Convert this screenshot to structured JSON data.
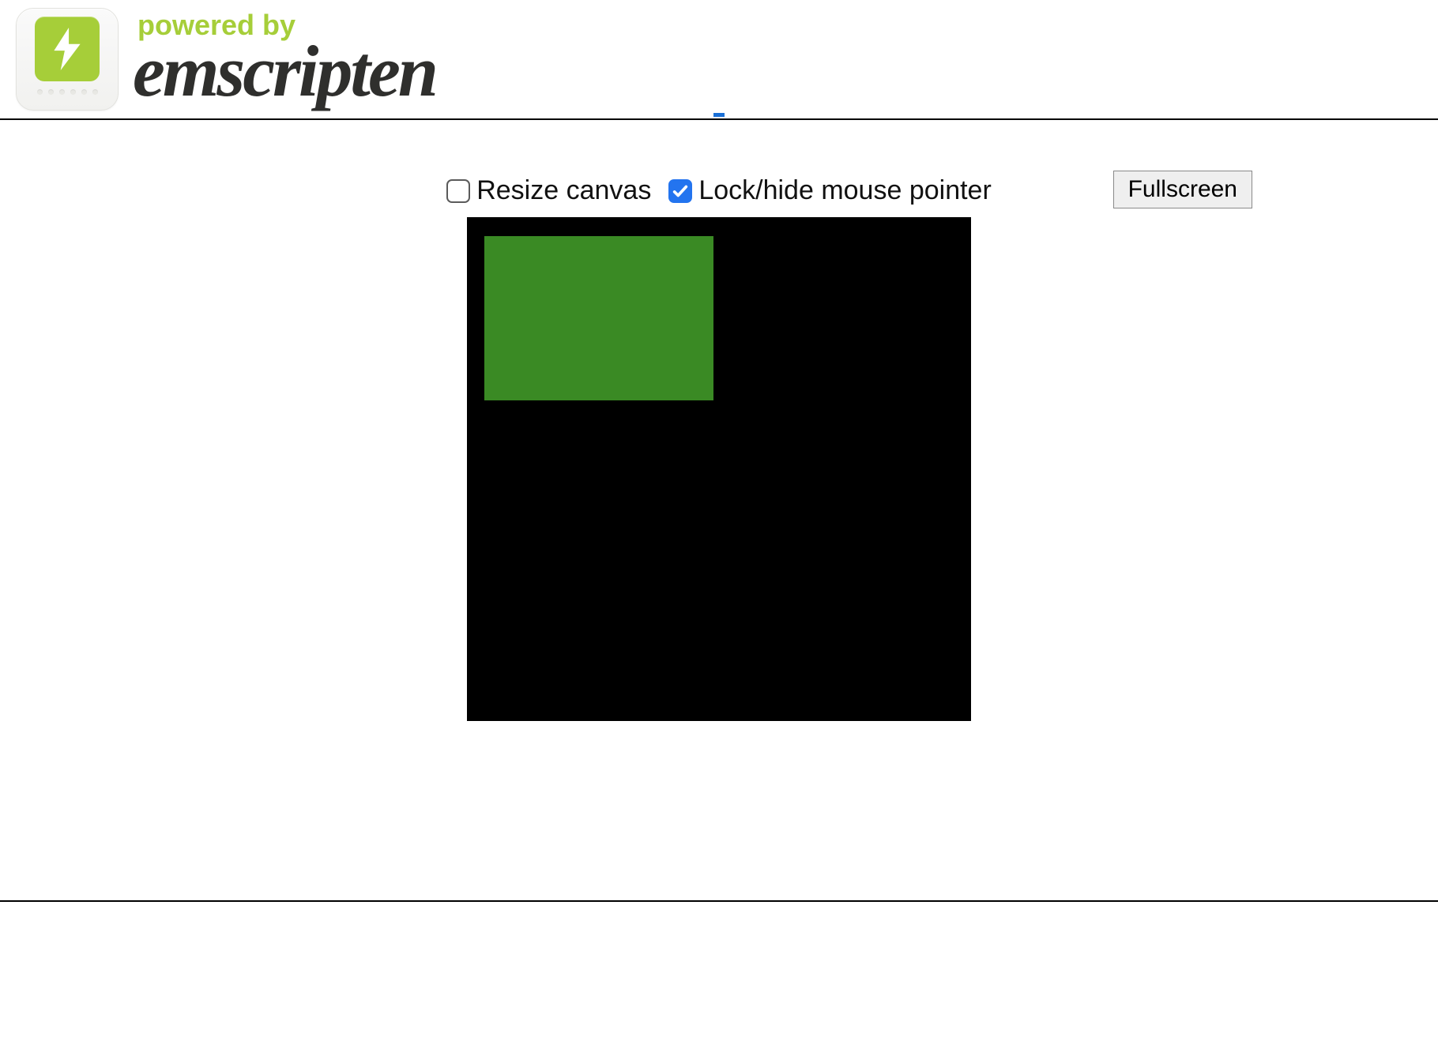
{
  "header": {
    "powered_by": "powered by",
    "brand": "emscripten"
  },
  "controls": {
    "resize_label": "Resize canvas",
    "resize_checked": false,
    "lock_label": "Lock/hide mouse pointer",
    "lock_checked": true,
    "fullscreen_label": "Fullscreen"
  },
  "canvas": {
    "bg_color": "#000000",
    "overlay_color": "#3a8a24"
  }
}
